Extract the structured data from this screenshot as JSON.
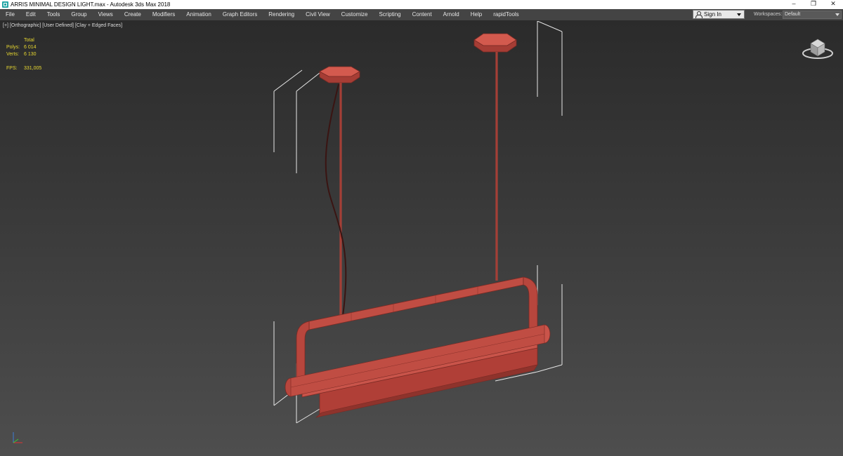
{
  "window": {
    "title": "ARRIS MINIMAL DESIGN LIGHT.max - Autodesk 3ds Max 2018",
    "controls": {
      "minimize": "–",
      "maximize": "❐",
      "close": "✕"
    }
  },
  "menubar": {
    "items": [
      {
        "label": "File"
      },
      {
        "label": "Edit"
      },
      {
        "label": "Tools"
      },
      {
        "label": "Group"
      },
      {
        "label": "Views"
      },
      {
        "label": "Create"
      },
      {
        "label": "Modifiers"
      },
      {
        "label": "Animation"
      },
      {
        "label": "Graph Editors"
      },
      {
        "label": "Rendering"
      },
      {
        "label": "Civil View"
      },
      {
        "label": "Customize"
      },
      {
        "label": "Scripting"
      },
      {
        "label": "Content"
      },
      {
        "label": "Arnold"
      },
      {
        "label": "Help"
      },
      {
        "label": "rapidTools"
      }
    ],
    "signin_label": "Sign In",
    "workspaces_label": "Workspaces:",
    "workspaces_value": "Default"
  },
  "viewport": {
    "label_plus": "[+]",
    "label_view": "[Orthographic]",
    "label_camera": "[User Defined]",
    "label_shading": "[Clay + Edged Faces]",
    "stats": {
      "total_label": "Total",
      "polys_label": "Polys:",
      "polys_value": "6 014",
      "verts_label": "Verts:",
      "verts_value": "6 130",
      "fps_label": "FPS:",
      "fps_value": "331,005"
    }
  },
  "colors": {
    "model": "#b8463d",
    "model_dark": "#7a2a24",
    "model_light": "#d35a4e",
    "bbox": "#e6e6e6",
    "stats_text": "#e8d830"
  },
  "icons": {
    "app": "3ds-max-icon",
    "user": "user-icon",
    "viewcube": "viewcube-icon",
    "axis": "axis-tripod-icon"
  }
}
